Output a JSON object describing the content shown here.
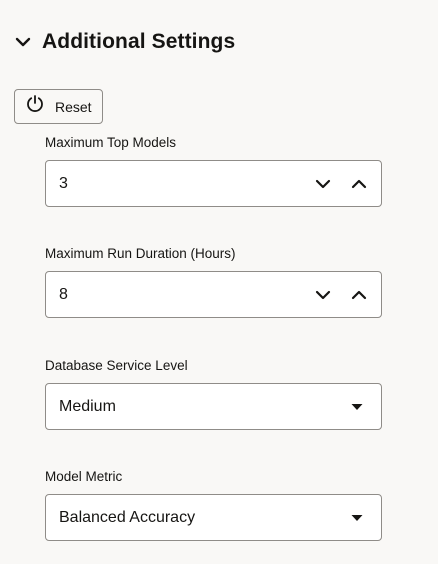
{
  "section": {
    "title": "Additional Settings",
    "expanded": true,
    "icon": "chevron-down-icon"
  },
  "reset_button": {
    "label": "Reset",
    "icon": "reset-icon"
  },
  "fields": {
    "max_top_models": {
      "label": "Maximum Top Models",
      "value": "3",
      "controls": [
        "chevron-down-icon",
        "chevron-up-icon"
      ]
    },
    "max_run_duration": {
      "label": "Maximum Run Duration (Hours)",
      "value": "8",
      "controls": [
        "chevron-down-icon",
        "chevron-up-icon"
      ]
    },
    "db_service_level": {
      "label": "Database Service Level",
      "value": "Medium",
      "control": "caret-down-icon"
    },
    "model_metric": {
      "label": "Model Metric",
      "value": "Balanced Accuracy",
      "control": "caret-down-icon"
    }
  },
  "colors": {
    "background": "#f9f8f6",
    "text": "#161513",
    "border": "#8f8c88",
    "input_background": "#ffffff"
  }
}
